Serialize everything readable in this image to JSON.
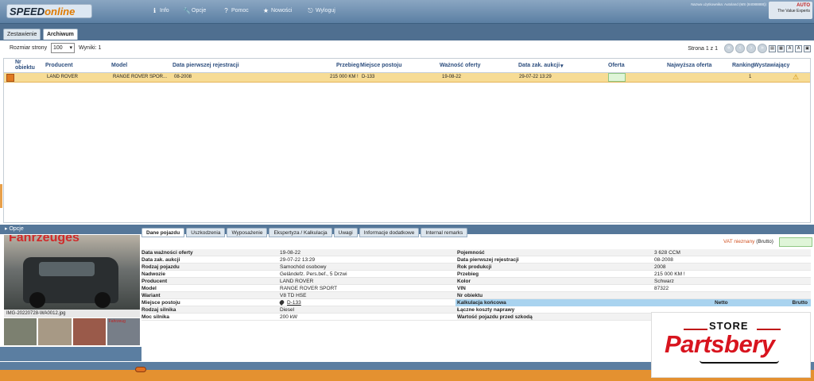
{
  "header": {
    "logo_prefix": "SPEED",
    "logo_suffix": "online",
    "nav": [
      {
        "label": "Info",
        "icon": "info-icon"
      },
      {
        "label": "Opcje",
        "icon": "wrench-icon"
      },
      {
        "label": "Pomoc",
        "icon": "help-icon"
      },
      {
        "label": "Nowości",
        "icon": "star-icon"
      },
      {
        "label": "Wyloguj",
        "icon": "logout-icon"
      }
    ],
    "user_info": "Nazwa użytkownika: Autoland (MS (84088888))",
    "brand_line1": "AUTO",
    "brand_line2": "The Value Experts"
  },
  "tabs": [
    "Zestawienie",
    "Archiwum"
  ],
  "toolbar": {
    "page_size_label": "Rozmiar strony",
    "page_size_value": "100",
    "results_label": "Wyniki: 1",
    "pager_label": "Strona 1 z 1"
  },
  "grid": {
    "columns": [
      "Nr obiektu",
      "Producent",
      "Model",
      "Data pierwszej rejestracji",
      "Przebieg",
      "Miejsce postoju",
      "Ważność oferty",
      "Data zak. aukcji",
      "Oferta",
      "Najwyższa oferta",
      "Ranking",
      "Wystawiający"
    ],
    "rows": [
      {
        "producer": "LAND ROVER",
        "model": "RANGE ROVER SPOR...",
        "first_reg": "08-2008",
        "mileage": "215 000 KM !",
        "location": "D-133",
        "valid_until": "19-08-22",
        "auction_end": "29-07-22 13:29",
        "ranking": "1"
      }
    ]
  },
  "splitter": {
    "label": "Opcje"
  },
  "detail": {
    "photo_text": "Fahrzeuges",
    "photo_caption": "IMG-20220728-WA0012.jpg",
    "thumb_label": "Fahrzeug",
    "tabs": [
      "Dane pojazdu",
      "Uszkodzenia",
      "Wyposażenie",
      "Ekspertyza / Kalkulacja",
      "Uwagi",
      "Informacje dodatkowe",
      "Internal remarks"
    ],
    "vat_red": "VAT nieznany",
    "vat_suffix": "(Brutto)",
    "left_fields": [
      {
        "k": "Data ważności oferty",
        "v": "19-08-22"
      },
      {
        "k": "Data zak. aukcji",
        "v": "29-07-22 13:29"
      },
      {
        "k": "Rodzaj pojazdu",
        "v": "Samochód osobowy"
      },
      {
        "k": "Nadwozie",
        "v": "Geländefz. Pers.bef., 5 Drzwi"
      },
      {
        "k": "Producent",
        "v": "LAND ROVER"
      },
      {
        "k": "Model",
        "v": "RANGE ROVER SPORT"
      },
      {
        "k": "Wariant",
        "v": "V8 TD HSE"
      },
      {
        "k": "Miejsce postoju",
        "v": "D-133"
      },
      {
        "k": "Rodzaj silnika",
        "v": "Diesel"
      },
      {
        "k": "Moc silnika",
        "v": "200 kW"
      }
    ],
    "right_fields": [
      {
        "k": "Pojemność",
        "v": "3 628 CCM"
      },
      {
        "k": "Data pierwszej rejestracji",
        "v": "08-2008"
      },
      {
        "k": "Rok produkcji",
        "v": "2008"
      },
      {
        "k": "Przebieg",
        "v": "215 000 KM !"
      },
      {
        "k": "Kolor",
        "v": "Schwarz"
      },
      {
        "k": "VIN",
        "v": "87322"
      },
      {
        "k": "Nr obiektu",
        "v": ""
      }
    ],
    "calc_title": "Kalkulacja końcowa",
    "calc_netto": "Netto",
    "calc_brutto": "Brutto",
    "calc_rows": [
      "Łączne koszty naprawy",
      "Wartość pojazdu przed szkodą"
    ]
  },
  "watermark": {
    "store": "STORE",
    "name": "Partsbery"
  }
}
